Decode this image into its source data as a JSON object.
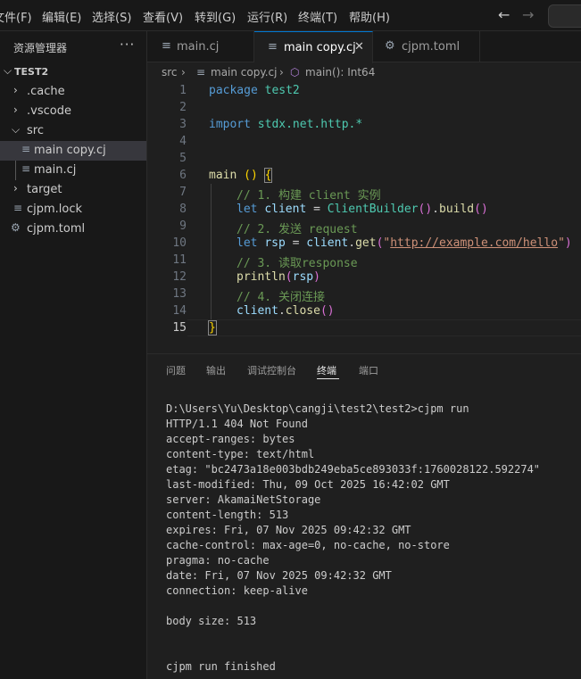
{
  "menu": [
    "文件(F)",
    "编辑(E)",
    "选择(S)",
    "查看(V)",
    "转到(G)",
    "运行(R)",
    "终端(T)",
    "帮助(H)"
  ],
  "nav": {
    "back_icon": "arrow-left-icon",
    "forward_icon": "arrow-right-icon"
  },
  "sidebar": {
    "title": "资源管理器",
    "more": "···",
    "root": "TEST2",
    "items": [
      ".cache",
      ".vscode",
      "src",
      "main copy.cj",
      "main.cj",
      "target",
      "cjpm.lock",
      "cjpm.toml"
    ]
  },
  "tabs": [
    {
      "label": "main.cj",
      "icon": "file-lines-icon"
    },
    {
      "label": "main copy.cj",
      "icon": "file-lines-icon",
      "active": true,
      "close": "✕"
    },
    {
      "label": "cjpm.toml",
      "icon": "gear-icon"
    }
  ],
  "breadcrumb": {
    "folder": "src",
    "file": "main copy.cj",
    "symbol": "main(): Int64"
  },
  "editor": {
    "line_numbers": [
      "1",
      "2",
      "3",
      "4",
      "5",
      "6",
      "7",
      "8",
      "9",
      "10",
      "11",
      "12",
      "13",
      "14",
      "15"
    ],
    "current_line": 15,
    "code": {
      "l1_kw": "package",
      "l1_pkg": "test2",
      "l3_kw": "import",
      "l3_path": "stdx.net.http.*",
      "l6_fn": "main",
      "l6_rest": " () ",
      "l6_brace": "{",
      "l7": "// 1. 构建 client 实例",
      "l8_kw": "let",
      "l8_var": "client",
      "l8_eq": " = ",
      "l8_cls": "ClientBuilder",
      "l8_p1": "()",
      "l8_dot": ".",
      "l8_fn": "build",
      "l8_p2": "()",
      "l9": "// 2. 发送 request",
      "l10_kw": "let",
      "l10_var": "rsp",
      "l10_eq": " = ",
      "l10_obj": "client",
      "l10_dot": ".",
      "l10_fn": "get",
      "l10_open": "(",
      "l10_q1": "\"",
      "l10_url": "http://example.com/hello",
      "l10_q2": "\"",
      "l10_close": ")",
      "l11": "// 3. 读取response",
      "l12_fn": "println",
      "l12_open": "(",
      "l12_arg": "rsp",
      "l12_close": ")",
      "l13": "// 4. 关闭连接",
      "l14_obj": "client",
      "l14_dot": ".",
      "l14_fn": "close",
      "l14_p": "()",
      "l15_brace": "}"
    }
  },
  "panel": {
    "tabs": [
      "问题",
      "输出",
      "调试控制台",
      "终端",
      "端口"
    ],
    "active_tab": "终端",
    "terminal": [
      "D:\\Users\\Yu\\Desktop\\cangji\\test2\\test2>cjpm run",
      "HTTP/1.1 404 Not Found",
      "accept-ranges: bytes",
      "content-type: text/html",
      "etag: \"bc2473a18e003bdb249eba5ce893033f:1760028122.592274\"",
      "last-modified: Thu, 09 Oct 2025 16:42:02 GMT",
      "server: AkamaiNetStorage",
      "content-length: 513",
      "expires: Fri, 07 Nov 2025 09:42:32 GMT",
      "cache-control: max-age=0, no-cache, no-store",
      "pragma: no-cache",
      "date: Fri, 07 Nov 2025 09:42:32 GMT",
      "connection: keep-alive",
      "",
      "body size: 513",
      "",
      "",
      "cjpm run finished"
    ]
  },
  "colors": {
    "accent": "#0078d4",
    "keyword": "#569cd6",
    "comment": "#6a9955",
    "string": "#ce9178",
    "function": "#dcdcaa",
    "variable": "#9cdcfe",
    "class": "#4ec9b0"
  }
}
